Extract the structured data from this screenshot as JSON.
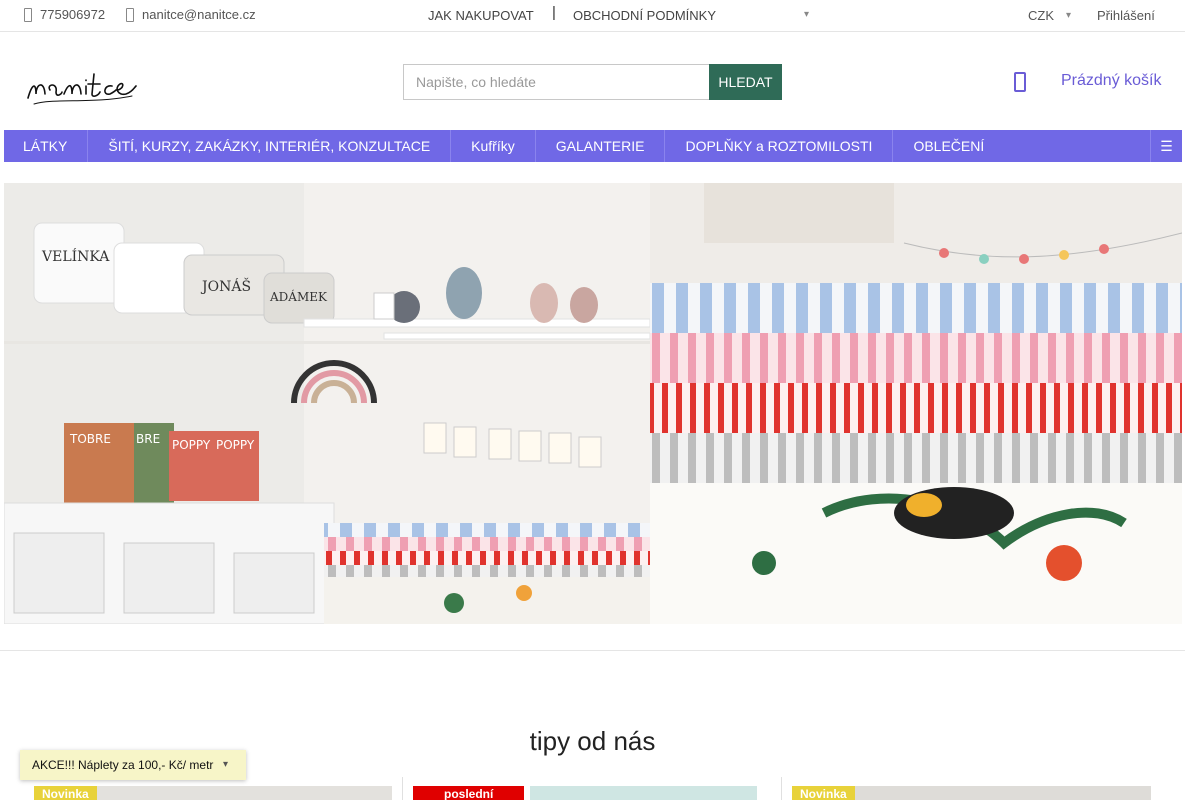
{
  "topbar": {
    "phone": "775906972",
    "email": "nanitce@nanitce.cz",
    "how_to_buy": "JAK NAKUPOVAT",
    "separator": "|",
    "terms": "OBCHODNÍ PODMÍNKY",
    "currency": "CZK",
    "login": "Přihlášení"
  },
  "header": {
    "logo_text": "nanitce",
    "search_placeholder": "Napište, co hledáte",
    "search_button": "HLEDAT",
    "cart_label": "Prázdný košík"
  },
  "nav": {
    "items": [
      {
        "label": "LÁTKY"
      },
      {
        "label": "ŠITÍ, KURZY, ZAKÁZKY, INTERIÉR, KONZULTACE"
      },
      {
        "label": "Kufříky"
      },
      {
        "label": "GALANTERIE"
      },
      {
        "label": "DOPLŇKY a ROZTOMILOSTI"
      },
      {
        "label": "OBLEČENÍ"
      }
    ]
  },
  "hero": {
    "case_labels": [
      "VELÍNKA",
      "JONÁŠ",
      "ADÁMEK"
    ],
    "book_labels": [
      "TOBRE",
      "BRE",
      "POPPY",
      "POPPY"
    ]
  },
  "section": {
    "title": "tipy od nás"
  },
  "products": [
    {
      "badge": "Novinka"
    },
    {
      "badge": "poslední"
    },
    {
      "badge": "Novinka"
    }
  ],
  "promo": {
    "text": "AKCE!!! Náplety za 100,- Kč/ metr"
  },
  "colors": {
    "accent": "#7068e6",
    "search_button": "#2f6b57",
    "badge_new": "#e8d23a",
    "badge_last": "#e00000"
  }
}
